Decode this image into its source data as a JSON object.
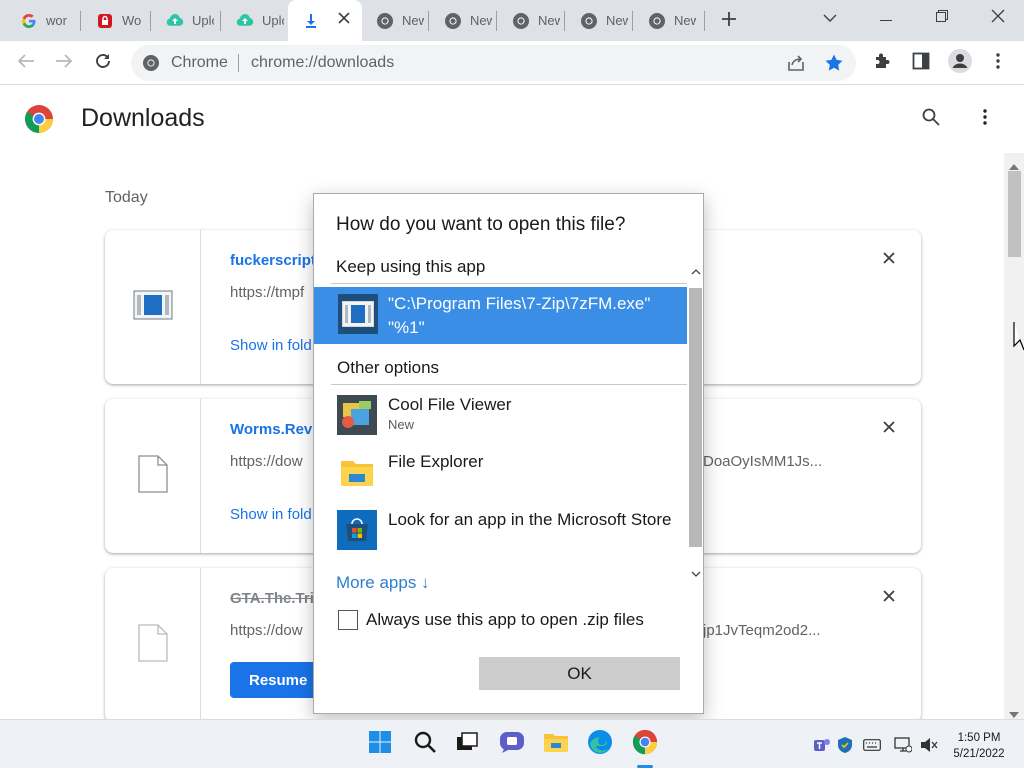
{
  "tabs": [
    {
      "label": "wor",
      "icon": "google-icon"
    },
    {
      "label": "Wo",
      "icon": "lock-shield-icon"
    },
    {
      "label": "Uplo",
      "icon": "upload-cloud-icon"
    },
    {
      "label": "Uplo",
      "icon": "upload-cloud-icon"
    },
    {
      "label": "",
      "icon": "download-icon",
      "active": true
    },
    {
      "label": "New",
      "icon": "chrome-icon"
    },
    {
      "label": "New",
      "icon": "chrome-icon"
    },
    {
      "label": "New",
      "icon": "chrome-icon"
    },
    {
      "label": "New",
      "icon": "chrome-icon"
    },
    {
      "label": "New",
      "icon": "chrome-icon"
    }
  ],
  "omnibox": {
    "site": "Chrome",
    "url": "chrome://downloads"
  },
  "page": {
    "title": "Downloads",
    "section": "Today"
  },
  "downloads": [
    {
      "name": "fuckerscript",
      "url": "https://tmpf",
      "url_right": "",
      "action": "Show in folder",
      "action_visible": "Show in fold",
      "icon": "archive-file-icon"
    },
    {
      "name": "Worms.Reve",
      "url": "https://dow",
      "url_right": "DoaOyIsMM1Js...",
      "action": "Show in folder",
      "action_visible": "Show in fold",
      "icon": "generic-file-icon"
    },
    {
      "name": "GTA.The.Tri",
      "url": "https://dow",
      "url_right": "jp1JvTeqm2od2...",
      "action": "Resume",
      "icon": "generic-file-icon"
    }
  ],
  "dialog": {
    "title": "How do you want to open this file?",
    "keep_label": "Keep using this app",
    "selected_app": "\"C:\\Program Files\\7-Zip\\7zFM.exe\" \"%1\"",
    "other_label": "Other options",
    "apps": [
      {
        "name": "Cool File Viewer",
        "sub": "New",
        "icon": "cool-file-viewer-icon"
      },
      {
        "name": "File Explorer",
        "sub": "",
        "icon": "folder-icon"
      },
      {
        "name": "Look for an app in the Microsoft Store",
        "sub": "",
        "icon": "microsoft-store-icon"
      }
    ],
    "more_apps": "More apps ↓",
    "always_label": "Always use this app to open .zip files",
    "ok_label": "OK"
  },
  "taskbar": {
    "time": "1:50 PM",
    "date": "5/21/2022",
    "apps": [
      "windows-start-icon",
      "search-icon",
      "task-view-icon",
      "chat-icon",
      "file-explorer-icon",
      "edge-icon",
      "chrome-icon"
    ]
  },
  "colors": {
    "accent": "#1a73e8",
    "selection": "#3a8ee6",
    "tabstrip": "#dee1e6"
  }
}
